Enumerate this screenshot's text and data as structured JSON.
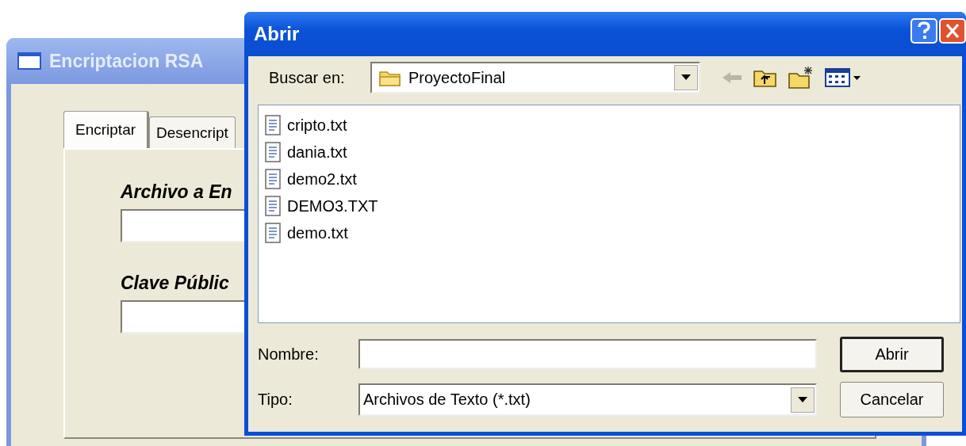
{
  "back_window": {
    "title": "Encriptacion RSA",
    "tabs": [
      {
        "label": "Encriptar",
        "selected": true
      },
      {
        "label": "Desencript",
        "selected": false
      }
    ],
    "fields": [
      {
        "label": "Archivo a En"
      },
      {
        "label": "Clave Públic"
      }
    ]
  },
  "dialog": {
    "title": "Abrir",
    "look_in": {
      "label": "Buscar en:",
      "value": "ProyectoFinal"
    },
    "files": [
      {
        "name": "cripto.txt"
      },
      {
        "name": "dania.txt"
      },
      {
        "name": "demo2.txt"
      },
      {
        "name": "DEMO3.TXT"
      },
      {
        "name": "demo.txt"
      }
    ],
    "name_field": {
      "label": "Nombre:"
    },
    "type_field": {
      "label": "Tipo:",
      "value": "Archivos de Texto (*.txt)"
    },
    "buttons": [
      {
        "label": "Abrir",
        "default": true
      },
      {
        "label": "Cancelar",
        "default": false
      }
    ]
  }
}
